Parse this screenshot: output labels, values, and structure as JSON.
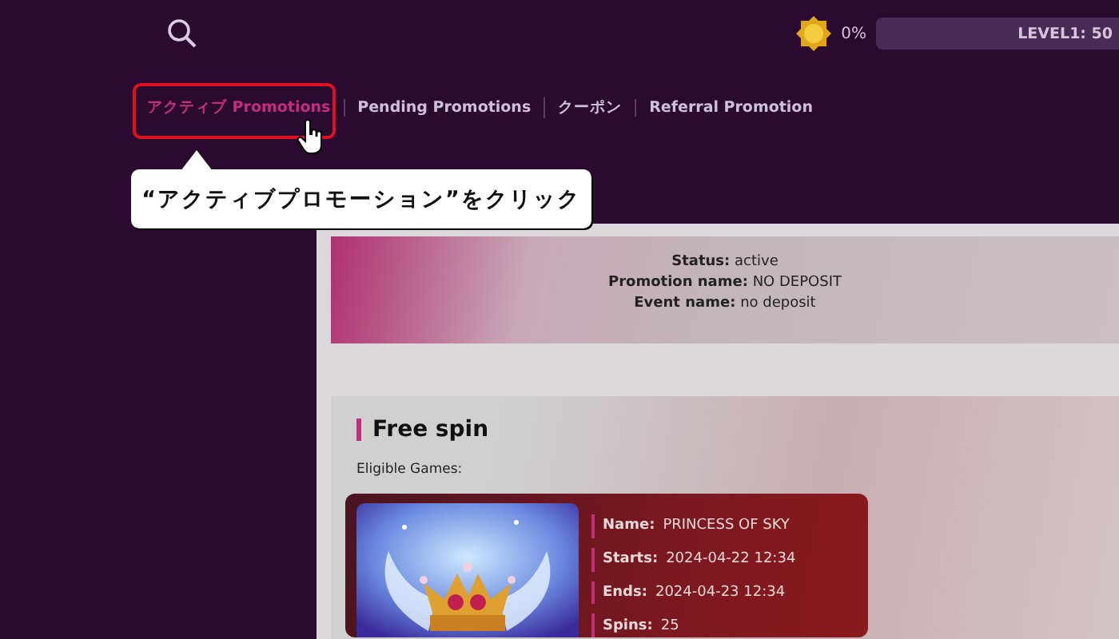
{
  "header": {
    "percent": "0%",
    "level_label": "LEVEL1: 50",
    "level": 0
  },
  "tabs": [
    {
      "label": "アクティブ Promotions",
      "selected": true
    },
    {
      "label": "Pending Promotions",
      "selected": false
    },
    {
      "label": "クーポン",
      "selected": false
    },
    {
      "label": "Referral Promotion",
      "selected": false
    }
  ],
  "annotation": {
    "text": "“アクティブプロモーション”をクリック"
  },
  "status": [
    {
      "label": "Status:",
      "value": "active"
    },
    {
      "label": "Promotion name:",
      "value": "NO DEPOSIT"
    },
    {
      "label": "Event name:",
      "value": "no deposit"
    }
  ],
  "section": {
    "title": "Free spin",
    "eligible_label": "Eligible Games:",
    "games": [
      {
        "kind": "picture",
        "fields": [
          {
            "label": "Name:",
            "value": "PRINCESS OF SKY"
          },
          {
            "label": "Starts:",
            "value": "2024-04-22 12:34"
          },
          {
            "label": "Ends:",
            "value": "2024-04-23 12:34"
          },
          {
            "label": "Spins:",
            "value": "25"
          }
        ]
      }
    ]
  }
}
